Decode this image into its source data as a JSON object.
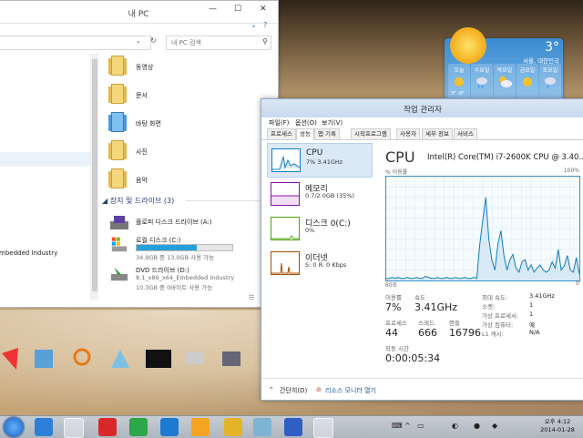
{
  "explorer": {
    "title": "내 PC",
    "search_placeholder": "내 PC 검색",
    "folders": [
      {
        "label": "동영상"
      },
      {
        "label": "문서"
      },
      {
        "label": "바탕 화면"
      },
      {
        "label": "사진"
      },
      {
        "label": "음악"
      }
    ],
    "section": {
      "label": "장치 및 드라이브",
      "count": "(3)"
    },
    "drives": [
      {
        "label": "플로피 디스크 드라이브 (A:)",
        "sub": ""
      },
      {
        "label": "로컬 디스크 (C:)",
        "sub": "34.9GB 중 13.0GB 사용 가능",
        "used_fraction": 0.63
      },
      {
        "label": "DVD 드라이브 (D:)",
        "sub1": "8.1_x86_x64_Embedded Industry",
        "sub2": "10.3GB 중 0바이트 사용 가능"
      }
    ],
    "nav_partial": "mbedded Industry"
  },
  "taskmgr": {
    "title": "작업 관리자",
    "menu": [
      "파일(F)",
      "옵션(O)",
      "보기(V)"
    ],
    "tabs": [
      "프로세스",
      "성능",
      "앱 기록",
      "시작프로그램",
      "사용자",
      "세부 정보",
      "서비스"
    ],
    "resources": [
      {
        "name": "CPU",
        "value": "7% 3.41GHz",
        "color": "#117dbb"
      },
      {
        "name": "메모리",
        "value": "0.7/2.0GB (35%)",
        "color": "#8b12ae"
      },
      {
        "name": "디스크 0(C:)",
        "value": "0%",
        "color": "#4da60c"
      },
      {
        "name": "이더넷",
        "value": "S: 0 R: 0 Kbps",
        "color": "#a74f01"
      }
    ],
    "cpu_heading": "CPU",
    "cpu_model": "Intel(R) Core(TM) i7-2600K CPU @ 3.40...",
    "util_label": "% 이용률",
    "util_max": "100%",
    "time_left": "60초",
    "time_right": "0",
    "stats": {
      "usage_label": "이용률",
      "usage": "7%",
      "speed_label": "속도",
      "speed": "3.41GHz",
      "proc_label": "프로세스",
      "proc": "44",
      "thread_label": "스레드",
      "thread": "666",
      "handle_label": "핸들",
      "handle": "16796",
      "uptime_label": "작동 시간",
      "uptime": "0:00:05:34"
    },
    "specs": [
      {
        "k": "최대 속도:",
        "v": "3.41GHz"
      },
      {
        "k": "소켓:",
        "v": "1"
      },
      {
        "k": "가상 프로세서:",
        "v": "1"
      },
      {
        "k": "가상 컴퓨터:",
        "v": "예"
      },
      {
        "k": "L1 캐시:",
        "v": "N/A"
      }
    ],
    "footer_brief": "간단히(D)",
    "footer_monitor": "리소스 모니터 열기",
    "cpu_history": [
      2,
      2,
      3,
      2,
      3,
      2,
      2,
      3,
      2,
      2,
      3,
      2,
      2,
      4,
      3,
      2,
      2,
      3,
      2,
      2,
      3,
      2,
      2,
      3,
      2,
      2,
      3,
      2,
      2,
      3,
      2,
      35,
      58,
      80,
      40,
      20,
      10,
      35,
      48,
      24,
      10,
      20,
      25,
      12,
      8,
      18,
      20,
      10,
      15,
      8,
      12,
      15,
      10,
      8,
      10,
      18,
      12,
      30,
      10,
      14,
      24,
      10,
      8,
      22,
      6
    ]
  },
  "weather": {
    "temp": "3°",
    "city": "서울, 대한민국",
    "days": [
      {
        "d": "오늘",
        "t": "3° -8°"
      },
      {
        "d": "수요일",
        "t": ""
      },
      {
        "d": "목요일",
        "t": ""
      },
      {
        "d": "금요일",
        "t": ""
      },
      {
        "d": "토요일",
        "t": ""
      }
    ]
  },
  "taskbar": {
    "time": "오후 4:12",
    "date": "2014-01-28"
  }
}
